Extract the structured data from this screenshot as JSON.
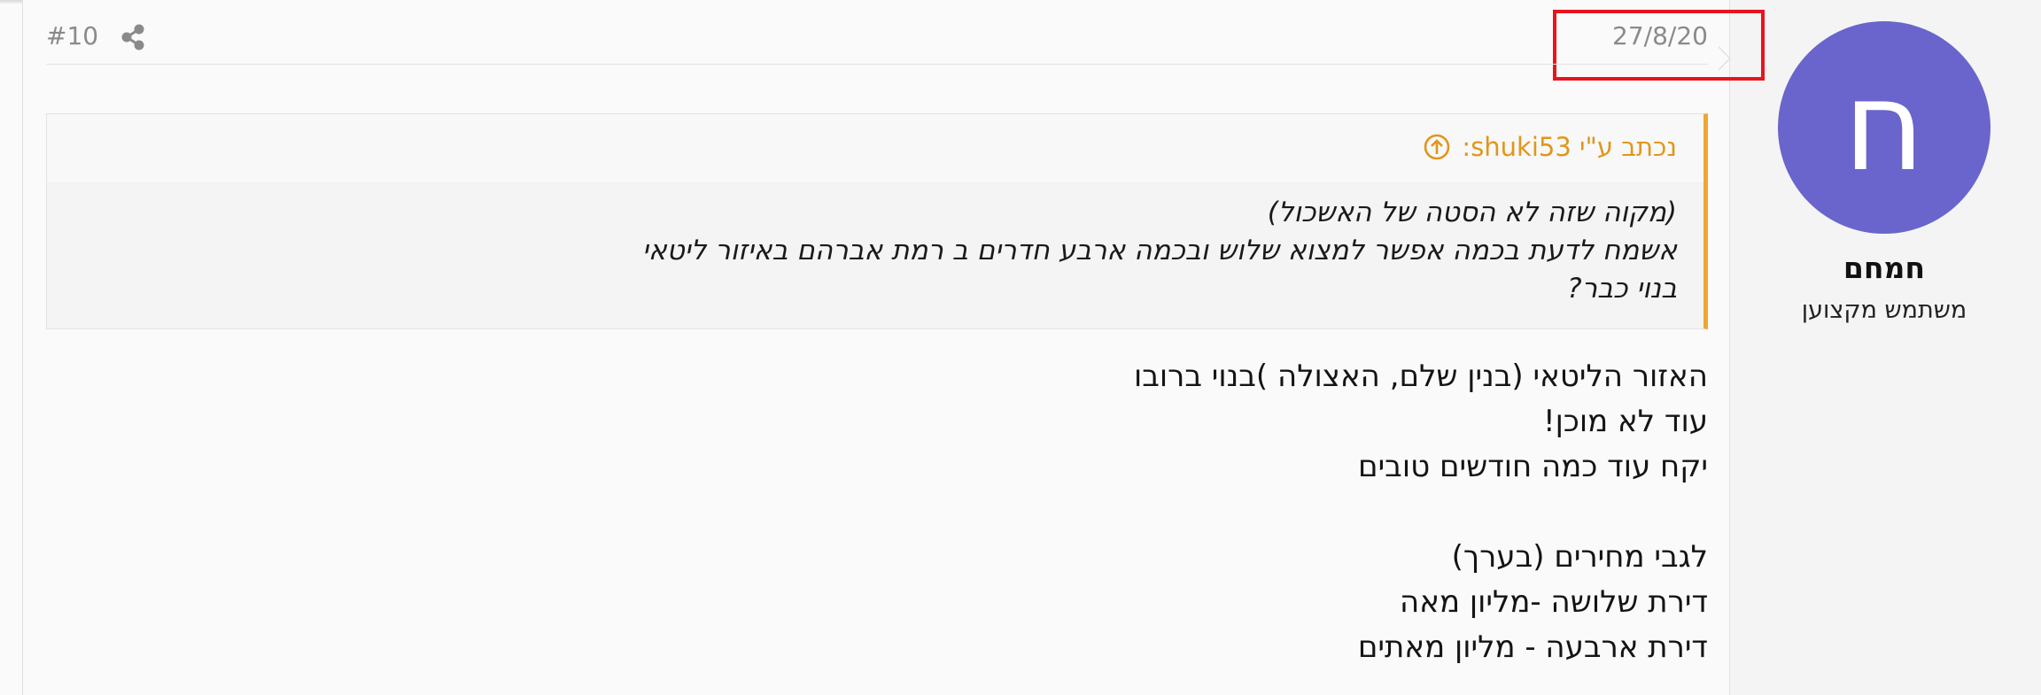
{
  "post": {
    "number": "#10",
    "date": "27/8/20"
  },
  "user": {
    "avatar_letter": "ח",
    "avatar_color": "#6a65cc",
    "name": "חמחם",
    "title": "משתמש מקצוען"
  },
  "quote": {
    "author": "shuki53",
    "attribution": "נכתב ע\"י shuki53:",
    "accent_color": "#f0a630",
    "lines": [
      "(מקוה שזה לא הסטה של האשכול)",
      "אשמח לדעת בכמה אפשר למצוא שלוש ובכמה ארבע חדרים ב רמת אברהם באיזור ליטאי",
      "בנוי כבר?"
    ]
  },
  "message": {
    "lines": [
      "האזור הליטאי (בנין שלם, האצולה )בנוי ברובו",
      "עוד לא מוכן!",
      "יקח עוד כמה חודשים טובים",
      "",
      "לגבי מחירים (בערך)",
      "דירת שלושה -מליון מאה",
      "דירת ארבעה - מליון מאתים"
    ]
  },
  "icons": {
    "share": "share-icon",
    "quote_jump": "arrow-up-circle-icon"
  },
  "highlight_color": "#e8141d"
}
